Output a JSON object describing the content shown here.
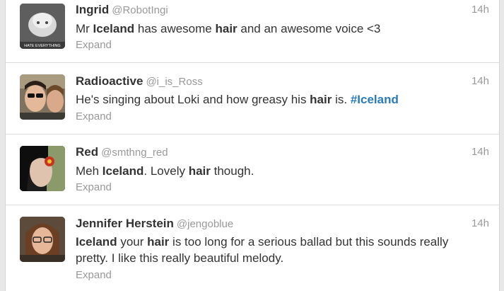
{
  "tweets": [
    {
      "name": "Ingrid",
      "handle": "@RobotIngi",
      "time": "14h",
      "expand": "Expand",
      "avatar_caption": "HATE EVERYTHING",
      "text": [
        {
          "t": "Mr ",
          "style": "normal"
        },
        {
          "t": "Iceland",
          "style": "bold"
        },
        {
          "t": " has awesome ",
          "style": "normal"
        },
        {
          "t": "hair",
          "style": "bold"
        },
        {
          "t": " and an awesome voice <3",
          "style": "normal"
        }
      ]
    },
    {
      "name": "Radioactive",
      "handle": "@i_is_Ross",
      "time": "14h",
      "expand": "Expand",
      "text": [
        {
          "t": "He's singing about Loki and how greasy his ",
          "style": "normal"
        },
        {
          "t": "hair",
          "style": "bold"
        },
        {
          "t": " is. ",
          "style": "normal"
        },
        {
          "t": "#Iceland",
          "style": "hashtag"
        }
      ]
    },
    {
      "name": "Red",
      "handle": "@smthng_red",
      "time": "14h",
      "expand": "Expand",
      "text": [
        {
          "t": "Meh ",
          "style": "normal"
        },
        {
          "t": "Iceland",
          "style": "bold"
        },
        {
          "t": ". Lovely ",
          "style": "normal"
        },
        {
          "t": "hair",
          "style": "bold"
        },
        {
          "t": " though.",
          "style": "normal"
        }
      ]
    },
    {
      "name": "Jennifer Herstein",
      "handle": "@jengoblue",
      "time": "14h",
      "expand": "Expand",
      "text": [
        {
          "t": "Iceland",
          "style": "bold"
        },
        {
          "t": " your ",
          "style": "normal"
        },
        {
          "t": "hair",
          "style": "bold"
        },
        {
          "t": " is too long for a serious ballad but this sounds really pretty. I like this really beautiful melody.",
          "style": "normal"
        }
      ]
    }
  ],
  "colors": {
    "name": "#333333",
    "meta": "#999999",
    "hashtag": "#2b7bb9",
    "divider": "#dcdcdc"
  }
}
